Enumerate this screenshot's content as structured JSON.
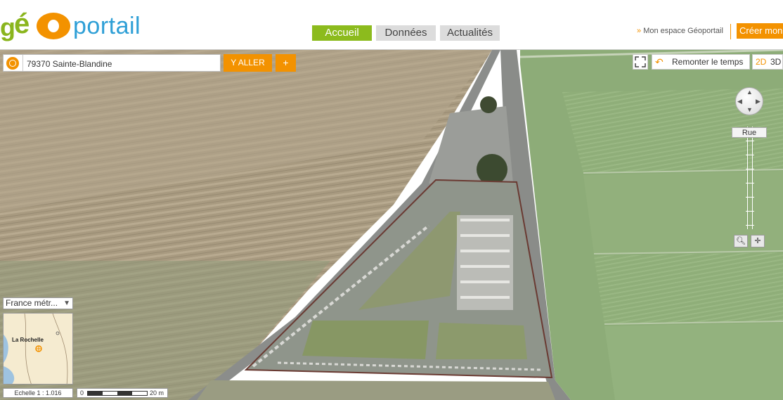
{
  "header": {
    "logo": {
      "g": "g",
      "e": "é",
      "portail": "portail"
    },
    "tabs": [
      {
        "label": "Accueil",
        "active": true
      },
      {
        "label": "Données",
        "active": false
      },
      {
        "label": "Actualités",
        "active": false
      }
    ],
    "espace_label": "Mon espace Géoportail",
    "creer_label": "Créer mon"
  },
  "search": {
    "value": "79370 Sainte-Blandine",
    "go_label": "Y ALLER",
    "plus_label": "+"
  },
  "tools": {
    "time_label": "Remonter le temps",
    "mode_2d": "2D",
    "mode_3d": "3D"
  },
  "navigation": {
    "zoom_level_label": "Rue"
  },
  "overview": {
    "territory": "France métr...",
    "place_label": "La Rochelle"
  },
  "scale": {
    "text": "Echelle 1 :  1.016",
    "zero": "0",
    "end": "20 m"
  },
  "colors": {
    "accent": "#f39200",
    "active_tab": "#8cbb1d",
    "logo_blue": "#2e9fd6"
  }
}
